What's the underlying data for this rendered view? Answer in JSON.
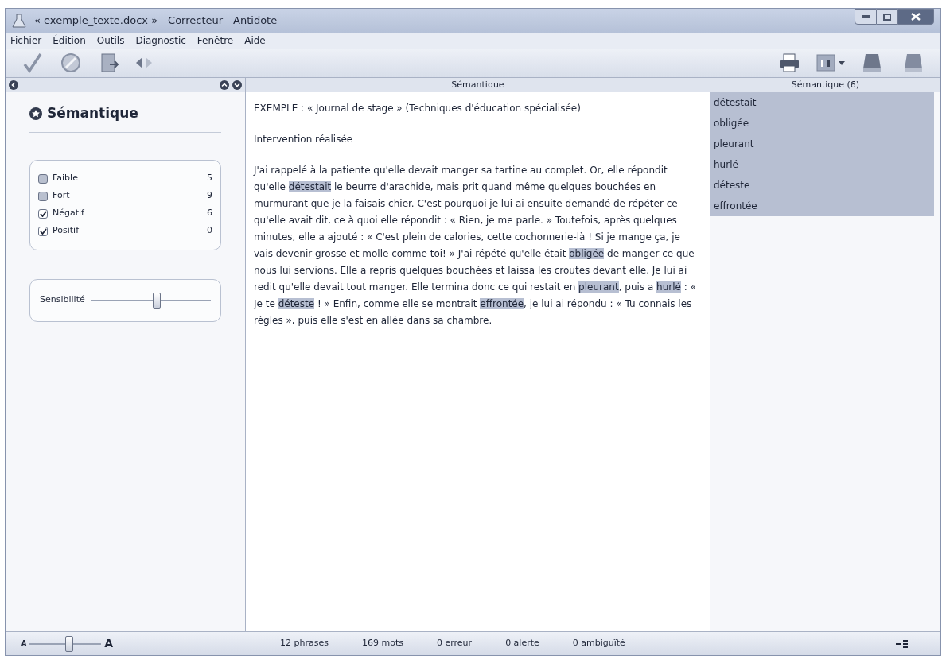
{
  "window": {
    "title": "« exemple_texte.docx » - Correcteur - Antidote"
  },
  "menu": [
    "Fichier",
    "Édition",
    "Outils",
    "Diagnostic",
    "Fenêtre",
    "Aide"
  ],
  "left_panel": {
    "title": "Sémantique",
    "filters": [
      {
        "label": "Faible",
        "count": "5",
        "checked": false
      },
      {
        "label": "Fort",
        "count": "9",
        "checked": false
      },
      {
        "label": "Négatif",
        "count": "6",
        "checked": true
      },
      {
        "label": "Positif",
        "count": "0",
        "checked": true
      }
    ],
    "sensitivity": {
      "label": "Sensibilité",
      "level": 0.55
    }
  },
  "center_panel": {
    "header": "Sémantique",
    "paragraphs": [
      [
        {
          "text": "EXEMPLE : « Journal de stage » (Techniques d'éducation spécialisée)",
          "highlighted": false
        }
      ],
      [
        {
          "text": "Intervention réalisée",
          "highlighted": false
        }
      ],
      [
        {
          "text": "J'ai rappelé à la patiente qu'elle devait manger sa tartine au complet. Or, elle répondit qu'elle ",
          "highlighted": false
        },
        {
          "text": "détestait",
          "highlighted": true
        },
        {
          "text": " le beurre d'arachide, mais prit quand même quelques bouchées en murmurant que je la faisais chier. C'est pourquoi je lui ai ensuite demandé de répéter ce qu'elle avait dit, ce à quoi elle répondit : « Rien, je me parle. » Toutefois, après quelques minutes, elle a ajouté : « C'est plein de calories, cette cochonnerie-là ! Si je mange ça, je vais devenir grosse et molle comme toi! » J'ai répété qu'elle était ",
          "highlighted": false
        },
        {
          "text": "obligée",
          "highlighted": true
        },
        {
          "text": " de manger ce que nous lui servions. Elle a repris quelques bouchées et laissa les croutes devant elle. Je lui ai redit qu'elle devait tout manger. Elle termina donc ce qui restait en ",
          "highlighted": false
        },
        {
          "text": "pleurant",
          "highlighted": true
        },
        {
          "text": ", puis a ",
          "highlighted": false
        },
        {
          "text": "hurlé",
          "highlighted": true
        },
        {
          "text": " : « Je te ",
          "highlighted": false
        },
        {
          "text": "déteste",
          "highlighted": true
        },
        {
          "text": " ! » Enfin, comme elle se montrait ",
          "highlighted": false
        },
        {
          "text": "effrontée",
          "highlighted": true
        },
        {
          "text": ", je lui ai répondu : « Tu connais les règles », puis elle s'est en allée dans sa chambre.",
          "highlighted": false
        }
      ]
    ]
  },
  "right_panel": {
    "header": "Sémantique (6)",
    "items": [
      {
        "label": "détestait",
        "selected": true
      },
      {
        "label": "obligée",
        "selected": true
      },
      {
        "label": "pleurant",
        "selected": true
      },
      {
        "label": "hurlé",
        "selected": true
      },
      {
        "label": "déteste",
        "selected": true
      },
      {
        "label": "effrontée",
        "selected": true
      }
    ]
  },
  "status_bar": {
    "zoom": {
      "small_label": "A",
      "large_label": "A",
      "level": 0.55
    },
    "stats": [
      "12 phrases",
      "169 mots",
      "0 erreur",
      "0 alerte",
      "0 ambiguïté"
    ]
  }
}
